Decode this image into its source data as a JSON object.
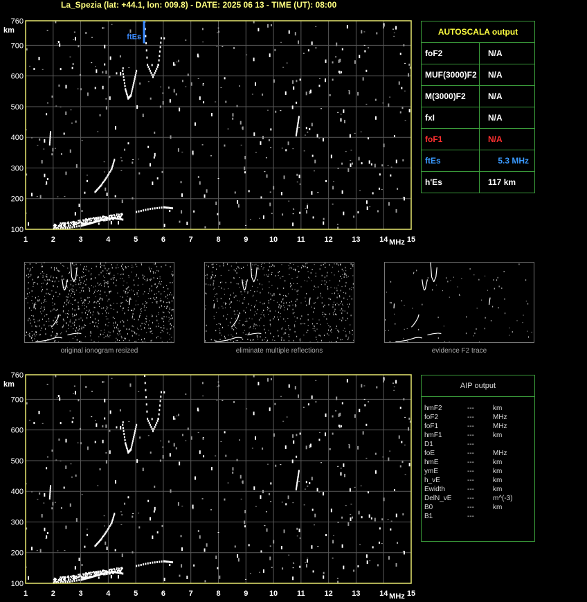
{
  "header": {
    "title": "La_Spezia (lat: +44.1, lon: 009.8) - DATE: 2025 06 13 - TIME (UT): 08:00"
  },
  "axes": {
    "y_unit": "km",
    "x_unit": "MHz",
    "y_ticks": [
      "760",
      "700",
      "600",
      "500",
      "400",
      "300",
      "200",
      "100"
    ],
    "x_ticks": [
      "1",
      "2",
      "3",
      "4",
      "5",
      "6",
      "7",
      "8",
      "9",
      "10",
      "11",
      "12",
      "13",
      "14",
      "15"
    ]
  },
  "autoscala": {
    "title": "AUTOSCALA output",
    "rows": [
      {
        "key": "foF2",
        "value": "N/A",
        "color": "#ffffff"
      },
      {
        "key": "MUF(3000)F2",
        "value": "N/A",
        "color": "#ffffff"
      },
      {
        "key": "M(3000)F2",
        "value": "N/A",
        "color": "#ffffff"
      },
      {
        "key": "fxI",
        "value": "N/A",
        "color": "#ffffff"
      },
      {
        "key": "foF1",
        "value": "N/A",
        "color": "#ff3030"
      },
      {
        "key": "ftEs",
        "value": "5.3 MHz",
        "color": "#3a9aff"
      },
      {
        "key": "h'Es",
        "value": "117     km",
        "color": "#ffffff"
      }
    ]
  },
  "ftes_label": "ftEs",
  "thumbnails": [
    {
      "caption": "original ionogram resized"
    },
    {
      "caption": "eliminate multiple reflections"
    },
    {
      "caption": "evidence F2 trace"
    }
  ],
  "aip": {
    "title": "AIP output",
    "rows": [
      {
        "param": "hmF2",
        "value": "---",
        "unit": "km"
      },
      {
        "param": "foF2",
        "value": "---",
        "unit": "MHz"
      },
      {
        "param": "foF1",
        "value": "---",
        "unit": "MHz"
      },
      {
        "param": "hmF1",
        "value": "---",
        "unit": "km"
      },
      {
        "param": "D1",
        "value": "---",
        "unit": ""
      },
      {
        "param": "foE",
        "value": "---",
        "unit": "MHz"
      },
      {
        "param": "hmE",
        "value": "---",
        "unit": "km"
      },
      {
        "param": "ymE",
        "value": "---",
        "unit": "km"
      },
      {
        "param": "h_vE",
        "value": "---",
        "unit": "km"
      },
      {
        "param": "Ewidth",
        "value": "---",
        "unit": "km"
      },
      {
        "param": "DelN_vE",
        "value": "---",
        "unit": "m^(-3)"
      },
      {
        "param": "B0",
        "value": "---",
        "unit": "km"
      },
      {
        "param": "B1",
        "value": "---",
        "unit": ""
      }
    ]
  },
  "chart_data": {
    "type": "scatter",
    "title": "La_Spezia (lat: +44.1, lon: 009.8) - DATE: 2025 06 13 - TIME (UT): 08:00",
    "xlabel": "MHz",
    "ylabel": "km",
    "xlim": [
      1,
      15
    ],
    "ylim": [
      100,
      760
    ],
    "grid": true,
    "series": [
      {
        "name": "",
        "x": [
          2.0,
          2.5,
          3.0,
          3.3,
          3.6,
          3.9,
          4.2,
          4.5
        ],
        "y": [
          105,
          108,
          115,
          122,
          130,
          138,
          140,
          135
        ]
      },
      {
        "name": "",
        "x": [
          3.5,
          3.7,
          3.9,
          4.1,
          4.2
        ],
        "y": [
          225,
          245,
          270,
          300,
          330
        ]
      },
      {
        "name": "",
        "x": [
          4.5,
          4.6,
          4.7,
          4.8,
          4.9,
          5.0
        ],
        "y": [
          620,
          560,
          530,
          540,
          580,
          620
        ]
      },
      {
        "name": "",
        "x": [
          5.3,
          5.4,
          5.6,
          5.8,
          5.9
        ],
        "y": [
          760,
          640,
          600,
          640,
          720
        ]
      },
      {
        "name": "",
        "x": [
          5.0,
          5.5,
          6.0,
          6.3
        ],
        "y": [
          160,
          170,
          175,
          172
        ]
      },
      {
        "name": "",
        "x": [
          10.8,
          10.85,
          10.9
        ],
        "y": [
          410,
          440,
          470
        ]
      },
      {
        "name": "",
        "x": [
          1.85,
          1.88
        ],
        "y": [
          380,
          420
        ]
      }
    ],
    "ftEs": 5.3
  }
}
